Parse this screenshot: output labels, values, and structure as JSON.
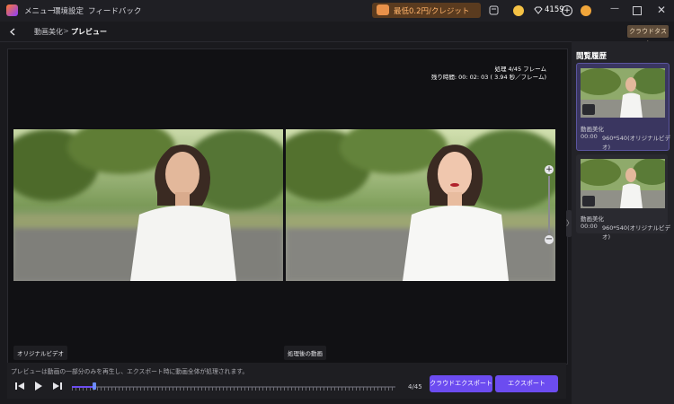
{
  "topbar": {
    "menu_items": [
      "メニュー",
      "環境設定",
      "フィードバック"
    ],
    "promo": "最低0.2円/クレジット",
    "credits": "4159"
  },
  "breadcrumb": {
    "parent": "動画美化",
    "separator": ">",
    "current": "プレビュー"
  },
  "cloud_task": "クラウドタスク",
  "preview": {
    "processing": "処理 4/45 フレーム",
    "remaining": "残り時間: 00: 02: 03 ( 3.94 秒／フレーム)",
    "label_original": "オリジナルビデオ",
    "label_processed": "処理後の動画"
  },
  "controls": {
    "notice": "プレビューは動画の一部分のみを再生し、エクスポート時に動画全体が処理されます。",
    "frame_counter": "4/45",
    "cloud_export": "クラウドエクスポート",
    "export": "エクスポート",
    "progress": 0.07
  },
  "history": {
    "title": "閲覧履歴",
    "items": [
      {
        "title": "動画美化",
        "time": "00:00",
        "resolution": "960*540(オリジナルビデオ)"
      },
      {
        "title": "動画美化",
        "time": "00:00",
        "resolution": "960*540(オリジナルビデオ)"
      }
    ]
  },
  "colors": {
    "accent": "#6c4cf0",
    "selected_card": "#3a3660"
  }
}
